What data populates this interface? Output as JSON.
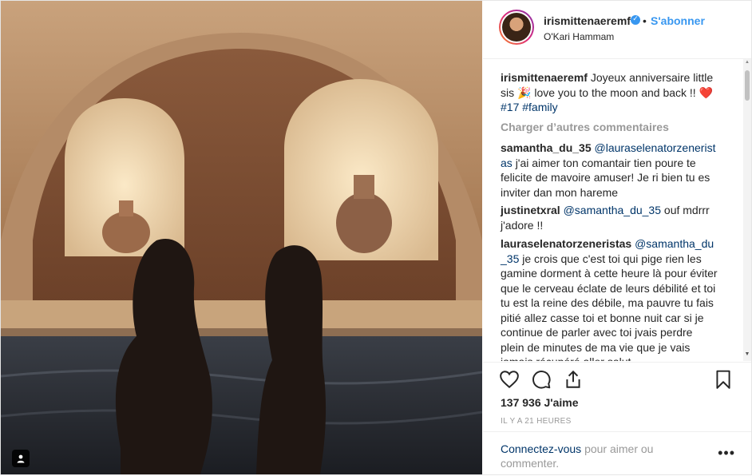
{
  "post": {
    "username": "irismittenaeremf",
    "verified_icon": "verified-badge-icon",
    "separator": "•",
    "follow_label": "S'abonner",
    "location": "O'Kari Hammam"
  },
  "caption": {
    "username": "irismittenaeremf",
    "text_1": "Joyeux anniversaire little sis",
    "emoji_1": "🎉",
    "text_2": "love you to the moon and back !!",
    "emoji_2": "❤️",
    "hashtag_1": "#17",
    "hashtag_2": "#family"
  },
  "load_more_label": "Charger d’autres commentaires",
  "comments": [
    {
      "username": "samantha_du_35",
      "mention": "@lauraselenatorzeneristas",
      "text": "j'ai aimer ton comantair tien poure te felicite de mavoire amuser! Je ri bien tu es inviter dan mon hareme"
    },
    {
      "username": "justinetxral",
      "mention": "@samantha_du_35",
      "text": "ouf mdrrr j'adore !!"
    },
    {
      "username": "lauraselenatorzeneristas",
      "mention": "@samantha_du_35",
      "text": "je crois que c'est toi qui pige rien les gamine dorment à cette heure là pour éviter que le cerveau éclate de leurs débilité et toi tu est la reine des débile, ma pauvre tu fais pitié allez casse toi et bonne nuit car si je continue de parler avec toi jvais perdre plein de minutes de ma vie que je vais jamais récupéré aller salut"
    }
  ],
  "likes_text": "137 936 J'aime",
  "time_text": "IL Y A 21 HEURES",
  "login": {
    "link": "Connectez-vous",
    "rest": "pour aimer ou commenter."
  },
  "more_label": "•••",
  "icons": {
    "like": "heart-icon",
    "comment": "comment-icon",
    "share": "share-icon",
    "save": "bookmark-icon",
    "tag": "user-tag-icon"
  }
}
